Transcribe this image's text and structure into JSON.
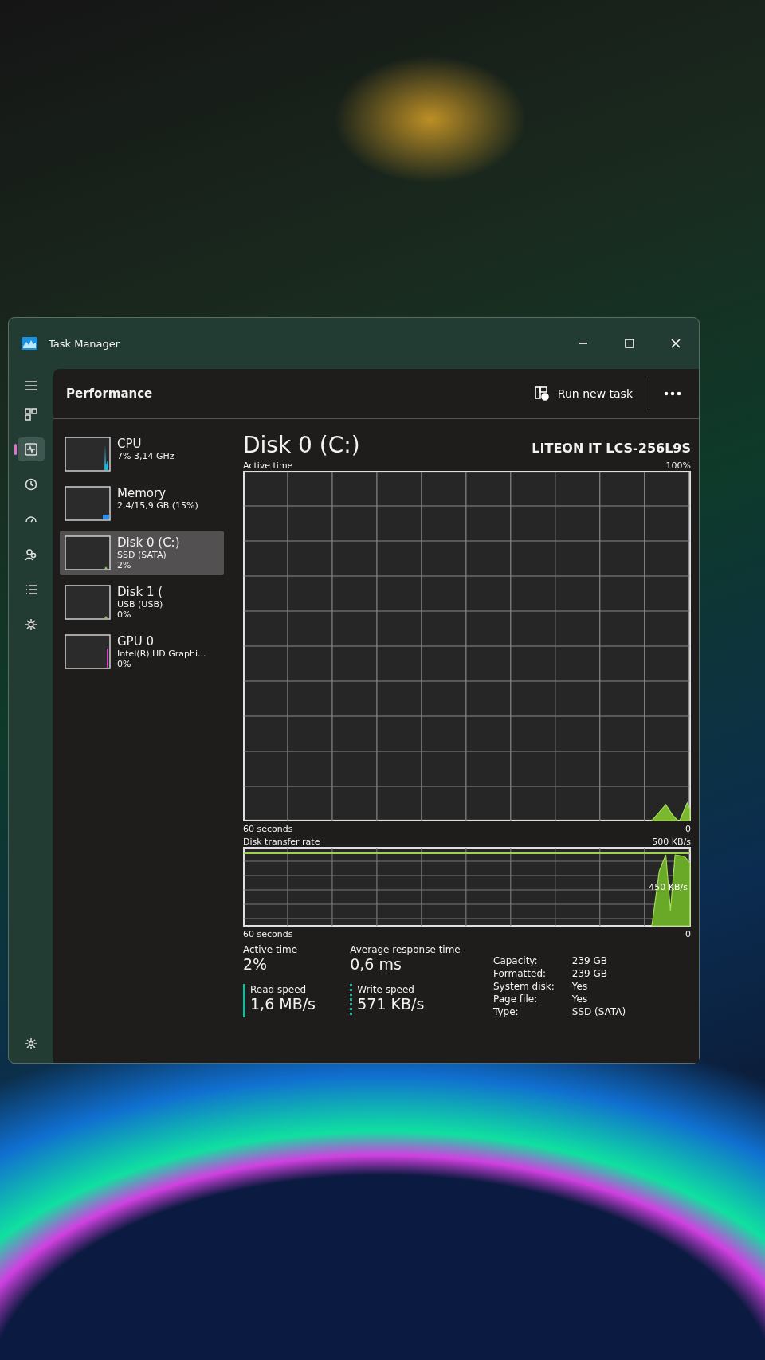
{
  "window": {
    "title": "Task Manager"
  },
  "nav_items": [
    {
      "selected": false
    },
    {
      "selected": true
    },
    {
      "selected": false
    },
    {
      "selected": false
    },
    {
      "selected": false
    },
    {
      "selected": false
    },
    {
      "selected": false
    }
  ],
  "header": {
    "title": "Performance",
    "run_task": "Run new task"
  },
  "devices": [
    {
      "name": "CPU",
      "detail": "7% 3,14 GHz",
      "color": "#17b8d8",
      "selected": false
    },
    {
      "name": "Memory",
      "detail": "2,4/15,9 GB (15%)",
      "color": "#2f8fe8",
      "selected": false
    },
    {
      "name": "Disk 0 (C:)",
      "detail": "SSD (SATA)",
      "value": "2%",
      "color": "#8cc63f",
      "selected": true
    },
    {
      "name": "Disk 1 (",
      "detail": "USB (USB)",
      "value": "0%",
      "color": "#8cc63f",
      "selected": false
    },
    {
      "name": "GPU 0",
      "detail": "Intel(R) HD Graphi...",
      "value": "0%",
      "color": "#d040c8",
      "selected": false
    }
  ],
  "detail": {
    "title": "Disk 0 (C:)",
    "model": "LITEON IT LCS-256L9S",
    "active_chart": {
      "label": "Active time",
      "max": "100%",
      "min": "0",
      "span": "60 seconds"
    },
    "transfer_chart": {
      "label": "Disk transfer rate",
      "max": "500 KB/s",
      "mid": "450 KB/s",
      "min": "0",
      "span": "60 seconds"
    },
    "stats": [
      {
        "label": "Active time",
        "value": "2%",
        "kind": "plain"
      },
      {
        "label": "Average response time",
        "value": "0,6 ms",
        "kind": "plain"
      },
      {
        "label": "Read speed",
        "value": "1,6 MB/s",
        "kind": "solid"
      },
      {
        "label": "Write speed",
        "value": "571 KB/s",
        "kind": "dotted"
      }
    ],
    "properties": [
      {
        "label": "Capacity:",
        "value": "239 GB"
      },
      {
        "label": "Formatted:",
        "value": "239 GB"
      },
      {
        "label": "System disk:",
        "value": "Yes"
      },
      {
        "label": "Page file:",
        "value": "Yes"
      },
      {
        "label": "Type:",
        "value": "SSD (SATA)"
      }
    ]
  }
}
